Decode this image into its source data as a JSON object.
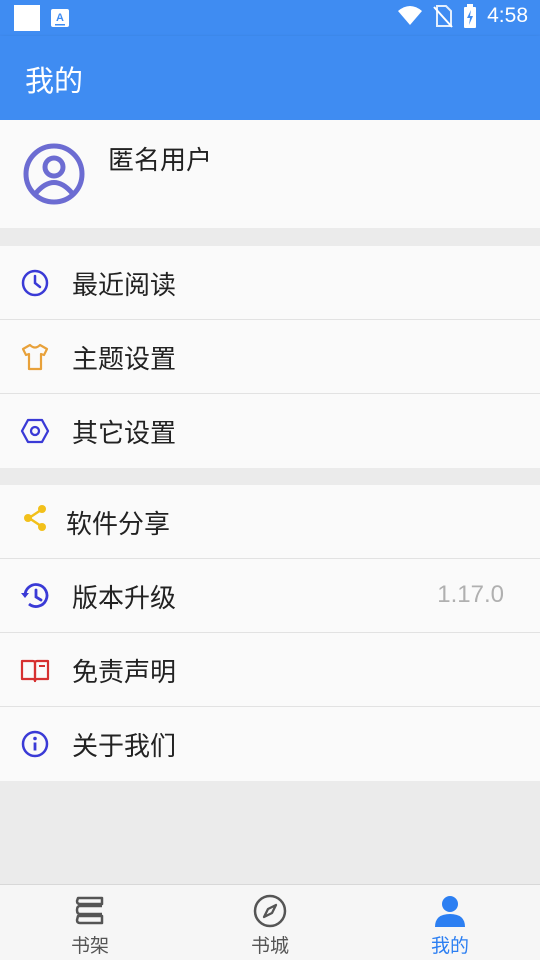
{
  "status_bar": {
    "time": "4:58"
  },
  "header": {
    "title": "我的"
  },
  "profile": {
    "username": "匿名用户"
  },
  "menu_group_1": [
    {
      "label": "最近阅读",
      "icon": "clock-icon",
      "color": "#3a3ad6"
    },
    {
      "label": "主题设置",
      "icon": "tshirt-icon",
      "color": "#e8a13a"
    },
    {
      "label": "其它设置",
      "icon": "hexagon-settings-icon",
      "color": "#3a3ad6"
    }
  ],
  "menu_group_2": [
    {
      "label": "软件分享",
      "icon": "share-icon",
      "color": "#f2c01a"
    },
    {
      "label": "版本升级",
      "icon": "history-icon",
      "color": "#3a3ad6",
      "value": "1.17.0"
    },
    {
      "label": "免责声明",
      "icon": "book-icon",
      "color": "#d63030"
    },
    {
      "label": "关于我们",
      "icon": "info-icon",
      "color": "#3a3ad6"
    }
  ],
  "bottom_nav": [
    {
      "label": "书架",
      "icon": "bookshelf-icon"
    },
    {
      "label": "书城",
      "icon": "compass-icon"
    },
    {
      "label": "我的",
      "icon": "person-icon",
      "active": true
    }
  ],
  "colors": {
    "primary": "#3f8cf2",
    "active_tab": "#2c7ff2"
  }
}
